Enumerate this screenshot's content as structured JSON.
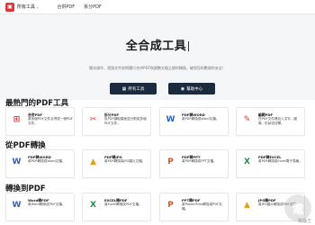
{
  "topbar": {
    "brand_text": "所有工具",
    "brand_caret": "⌄",
    "nav_merge": "合併PDF",
    "nav_split": "拆分PDF"
  },
  "hero": {
    "title": "全合成工具",
    "description": "簡化操作，透過文件前問題行合併PDF和調整文檔之間的轉換，確保您的數據的安全！",
    "btn_all": "所有工具",
    "btn_help": "幫助中心"
  },
  "sections": {
    "popular": "最熱門的PDF工具",
    "from_pdf": "從PDF轉換",
    "to_pdf": "轉換到PDF"
  },
  "cards": {
    "c1": {
      "icon": "merge-icon",
      "title": "合併PDF",
      "desc": "將多個PDF文件合併成一個PDF文件。"
    },
    "c2": {
      "icon": "scissors-icon",
      "title": "拆分PDF",
      "desc": "從PDF擷取頁面並分割成多個PDF文件。"
    },
    "c3": {
      "icon": "word-icon",
      "title": "PDF轉WORD",
      "desc": "將PDF轉換成Word文檔。"
    },
    "c4": {
      "icon": "edit-icon",
      "title": "編輯PDF",
      "desc": "在PDF文件裡加入文字、圖像、形狀或註釋。"
    },
    "c5": {
      "icon": "word-icon",
      "title": "PDF轉WORD",
      "desc": "將PDF轉換成Word文檔。"
    },
    "c6": {
      "icon": "image-icon",
      "title": "PDF轉JPG",
      "desc": "將PDF轉換為JPG圖片文檔。"
    },
    "c7": {
      "icon": "ppt-icon",
      "title": "PDF轉PPT",
      "desc": "將PDF轉換成PPT文檔。"
    },
    "c8": {
      "icon": "excel-icon",
      "title": "PDF轉EXCEL",
      "desc": "將PDF轉換成Excel電子表格。"
    },
    "c9": {
      "icon": "word-icon",
      "title": "Word轉PDF",
      "desc": "將Word轉換成PDF文檔。"
    },
    "c10": {
      "icon": "excel-icon",
      "title": "EXCEL轉PDF",
      "desc": "將Excel轉換成PDF文檔。"
    },
    "c11": {
      "icon": "ppt-icon",
      "title": "PPT轉PDF",
      "desc": "將PowerPoint轉換成PDF文檔。"
    },
    "c12": {
      "icon": "image-icon",
      "title": "JPG轉PDF",
      "desc": "將JPG圖片轉換成PDF文檔。"
    }
  },
  "colors": {
    "brand": "#e0323a",
    "dark_button": "#1b2a3e",
    "hero_bg": "#f5f6f8"
  },
  "watermark": {
    "glyph": "電",
    "text": "電腦王"
  }
}
